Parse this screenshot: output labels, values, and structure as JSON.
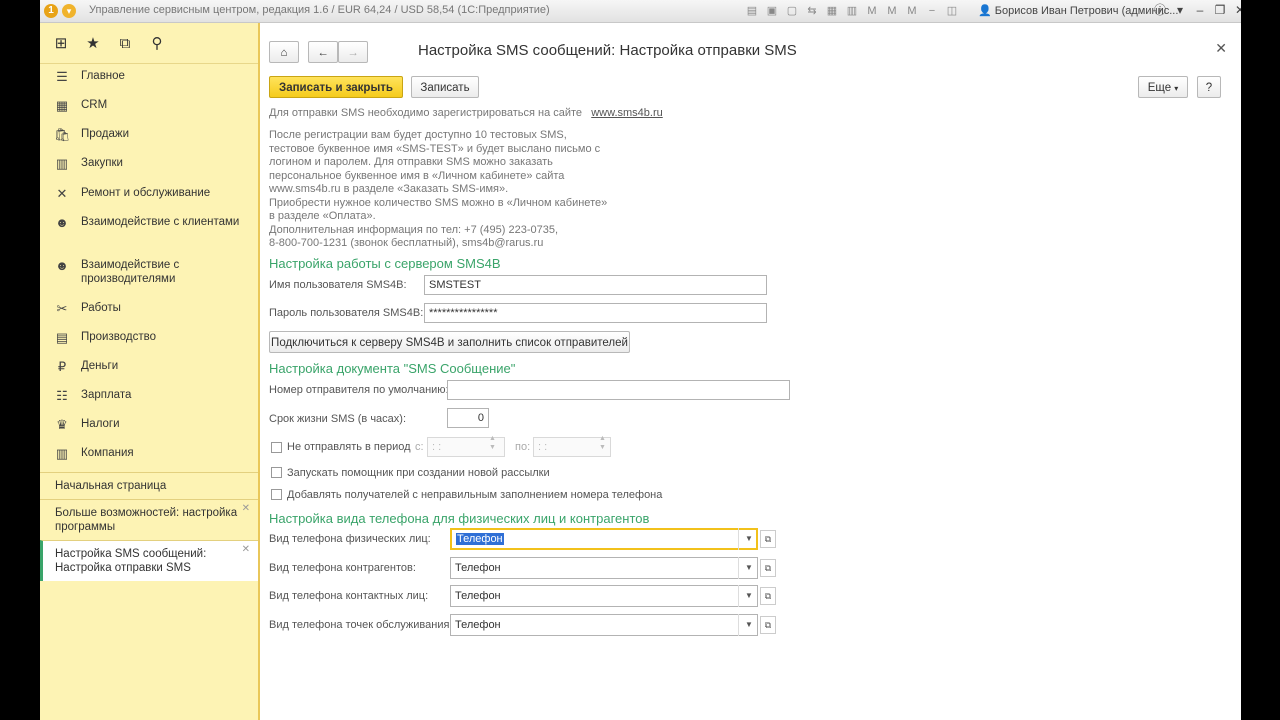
{
  "titlebar": {
    "title": "Управление сервисным центром, редакция 1.6 / EUR 64,24 / USD 58,54  (1С:Предприятие)",
    "user": "Борисов Иван Петрович (админис..."
  },
  "sidebar": {
    "items": [
      {
        "icon": "menu-icon",
        "glyph": "☰",
        "label": "Главное"
      },
      {
        "icon": "crm-icon",
        "glyph": "▦",
        "label": "CRM"
      },
      {
        "icon": "sales-icon",
        "glyph": "🛍",
        "label": "Продажи"
      },
      {
        "icon": "purchases-icon",
        "glyph": "▥",
        "label": "Закупки"
      },
      {
        "icon": "repair-icon",
        "glyph": "✕",
        "label": "Ремонт и обслуживание"
      },
      {
        "icon": "clients-icon",
        "glyph": "☻",
        "label": "Взаимодействие с клиентами"
      },
      {
        "icon": "producers-icon",
        "glyph": "☻",
        "label": "Взаимодействие с производителями"
      },
      {
        "icon": "works-icon",
        "glyph": "✂",
        "label": "Работы"
      },
      {
        "icon": "production-icon",
        "glyph": "▤",
        "label": "Производство"
      },
      {
        "icon": "money-icon",
        "glyph": "₽",
        "label": "Деньги"
      },
      {
        "icon": "salary-icon",
        "glyph": "☷",
        "label": "Зарплата"
      },
      {
        "icon": "taxes-icon",
        "glyph": "♛",
        "label": "Налоги"
      },
      {
        "icon": "company-icon",
        "glyph": "▥",
        "label": "Компания"
      }
    ],
    "open_windows": [
      {
        "label": "Начальная страница"
      },
      {
        "label": "Больше возможностей: настройка программы"
      },
      {
        "label": "Настройка SMS сообщений: Настройка отправки SMS"
      }
    ]
  },
  "form": {
    "title": "Настройка SMS сообщений: Настройка отправки SMS",
    "save_close_label": "Записать и закрыть",
    "save_label": "Записать",
    "more_label": "Еще",
    "help_label": "?",
    "register_text": "Для отправки SMS необходимо зарегистрироваться на сайте",
    "register_link": "www.sms4b.ru",
    "info_lines": [
      "После регистрации вам будет доступно 10 тестовых SMS,",
      "тестовое буквенное имя «SMS-TEST» и будет выслано письмо с",
      "логином и паролем. Для отправки SMS можно заказать",
      "персональное буквенное имя  в «Личном кабинете» сайта",
      "www.sms4b.ru в разделе «Заказать SMS-имя».",
      "Приобрести нужное количество SMS можно в «Личном кабинете»",
      "в разделе «Оплата».",
      "Дополнительная информация по тел: +7 (495) 223-0735,",
      "8-800-700-1231 (звонок бесплатный), sms4b@rarus.ru"
    ],
    "server": {
      "section_title": "Настройка работы с сервером SMS4B",
      "username_label": "Имя пользователя SMS4B:",
      "username_value": "SMSTEST",
      "password_label": "Пароль пользователя SMS4B:",
      "password_value": "****************",
      "connect_label": "Подключиться к серверу SMS4B и заполнить список отправителей"
    },
    "document": {
      "section_title": "Настройка документа \"SMS Сообщение\"",
      "sender_label": "Номер отправителя по умолчанию:",
      "sender_value": "",
      "lifetime_label": "Срок жизни SMS (в часах):",
      "lifetime_value": "0",
      "period_label": "Не отправлять в период",
      "from_label": "с:",
      "from_value": ": :",
      "to_label": "по:",
      "to_value": ": :",
      "assistant_label": "Запускать помощник при создании новой рассылки",
      "add_recipients_label": "Добавлять получателей с неправильным заполнением номера телефона"
    },
    "phones": {
      "section_title": "Настройка вида телефона для физических лиц и контрагентов",
      "rows": [
        {
          "label": "Вид телефона физических лиц:",
          "value": "Телефон"
        },
        {
          "label": "Вид телефона контрагентов:",
          "value": "Телефон"
        },
        {
          "label": "Вид телефона контактных лиц:",
          "value": "Телефон"
        },
        {
          "label": "Вид телефона точек обслуживания:",
          "value": "Телефон"
        }
      ]
    }
  }
}
